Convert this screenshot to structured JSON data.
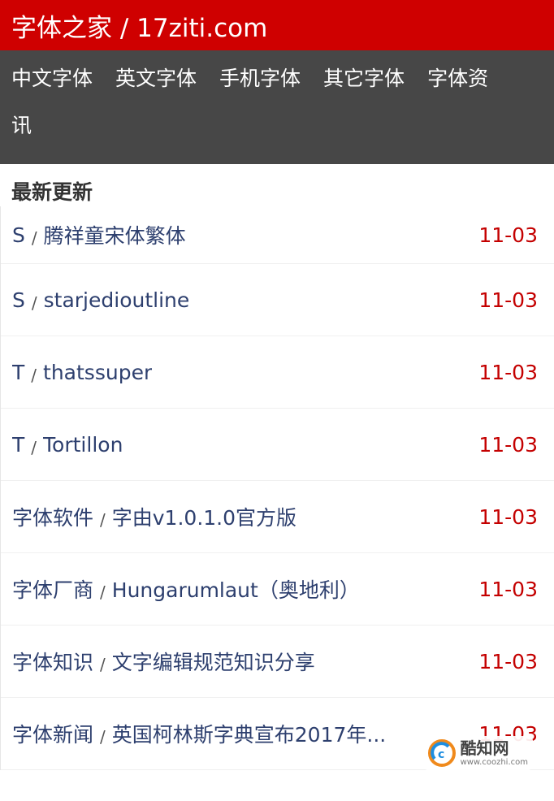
{
  "header": {
    "title": "字体之家 / 17ziti.com"
  },
  "nav": {
    "items": [
      "中文字体",
      "英文字体",
      "手机字体",
      "其它字体",
      "字体资"
    ],
    "overflow": "讯"
  },
  "section": {
    "title": "最新更新"
  },
  "list": [
    {
      "category": "S",
      "name": "腾祥童宋体繁体",
      "date": "11-03"
    },
    {
      "category": "S",
      "name": "starjedioutline",
      "date": "11-03"
    },
    {
      "category": "T",
      "name": "thatssuper",
      "date": "11-03"
    },
    {
      "category": "T",
      "name": "Tortillon",
      "date": "11-03"
    },
    {
      "category": "字体软件",
      "name": "字由v1.0.1.0官方版",
      "date": "11-03"
    },
    {
      "category": "字体厂商",
      "name": "Hungarumlaut（奥地利）",
      "date": "11-03"
    },
    {
      "category": "字体知识",
      "name": "文字编辑规范知识分享",
      "date": "11-03"
    },
    {
      "category": "字体新闻",
      "name": "英国柯林斯字典宣布2017年...",
      "date": "11-03"
    }
  ],
  "separator": "/",
  "watermark": {
    "title": "酷知网",
    "url": "www.coozhi.com",
    "logo_icon": "coozhi-logo-icon"
  },
  "colors": {
    "header_bg": "#cf0000",
    "nav_bg": "#474747",
    "date": "#c40000",
    "link": "#2d3f6e"
  }
}
